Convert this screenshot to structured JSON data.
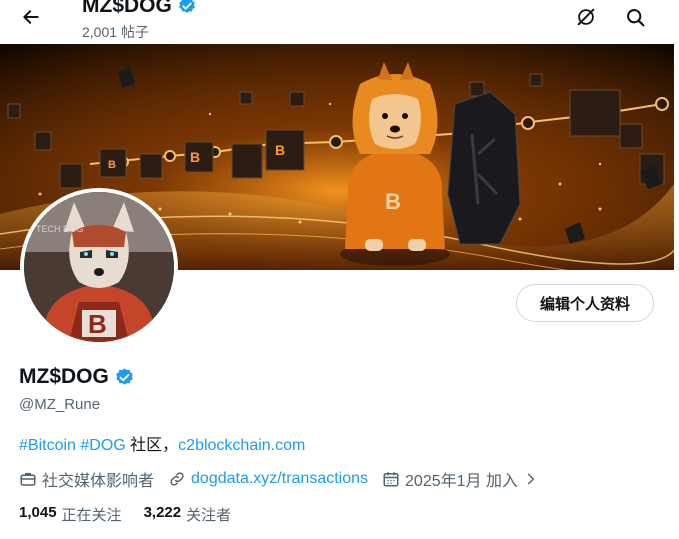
{
  "header": {
    "title": "MZ$DOG",
    "post_count": "2,001",
    "post_label": "帖子"
  },
  "profile": {
    "name": "MZ$DOG",
    "handle": "@MZ_Rune",
    "edit_button": "编辑个人资料",
    "bio": {
      "tag1": "#Bitcoin",
      "tag2": "#DOG",
      "text": " 社区，",
      "link": "c2blockchain.com"
    },
    "meta": {
      "category": "社交媒体影响者",
      "website": "dogdata.xyz/transactions",
      "joined": "2025年1月 加入"
    },
    "following_count": "1,045",
    "following_label": "正在关注",
    "followers_count": "3,222",
    "followers_label": "关注者"
  },
  "icons": {
    "back": "arrow-left-icon",
    "grok": "slash-circle-icon",
    "search": "search-icon",
    "verified": "verified-badge-icon",
    "category": "briefcase-icon",
    "website": "link-icon",
    "joined": "calendar-icon",
    "chevron": "chevron-right-icon"
  },
  "colors": {
    "accent": "#1d9bf0",
    "text": "#0f1419",
    "muted": "#536471",
    "border": "#cfd9de"
  }
}
